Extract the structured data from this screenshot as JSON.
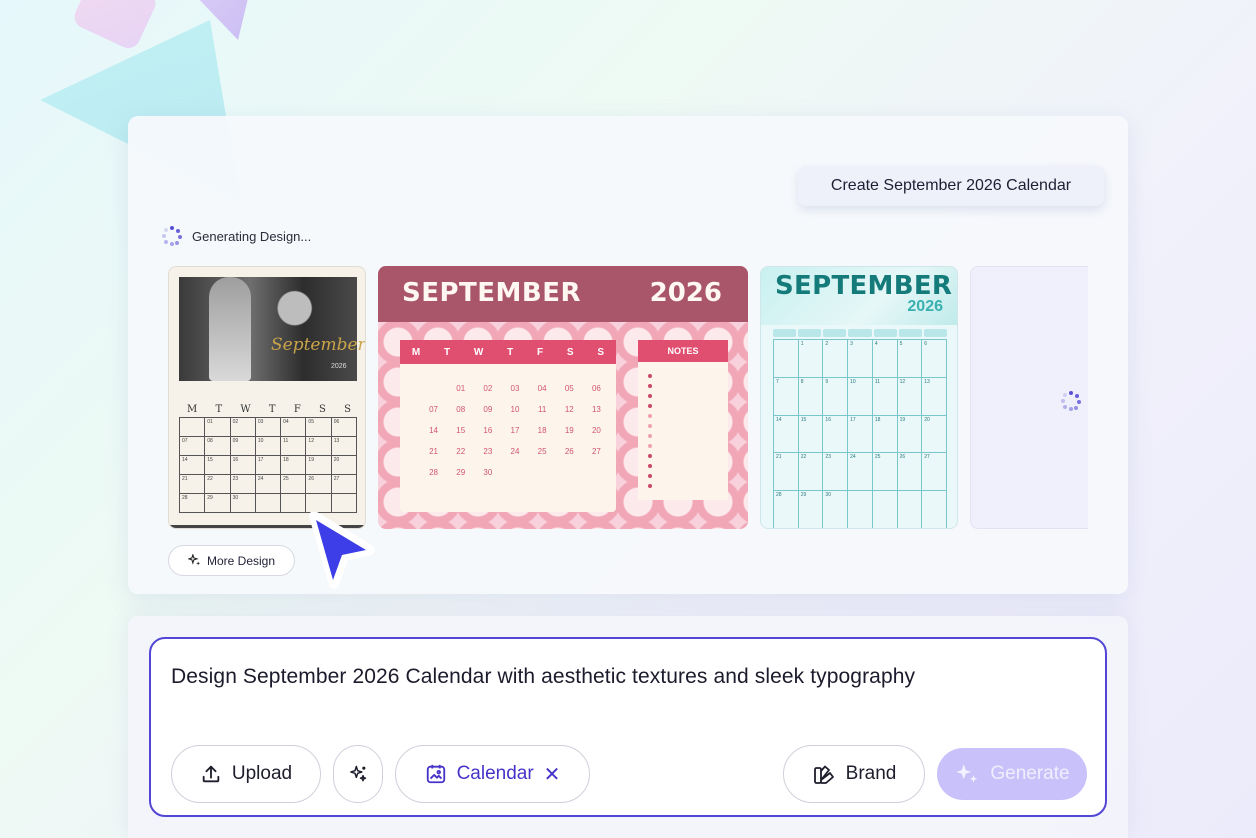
{
  "top_panel": {
    "create_pill": "Create September 2026 Calendar",
    "status": "Generating Design...",
    "more_design": "More Design"
  },
  "card1": {
    "script_title": "September",
    "year": "2026",
    "weekdays": [
      "M",
      "T",
      "W",
      "T",
      "F",
      "S",
      "S"
    ],
    "cells": [
      "",
      "01",
      "02",
      "03",
      "04",
      "05",
      "06",
      "07",
      "08",
      "09",
      "10",
      "11",
      "12",
      "13",
      "14",
      "15",
      "16",
      "17",
      "18",
      "19",
      "20",
      "21",
      "22",
      "23",
      "24",
      "25",
      "26",
      "27",
      "28",
      "29",
      "30",
      "",
      "",
      "",
      ""
    ]
  },
  "card2": {
    "month": "SEPTEMBER",
    "year": "2026",
    "weekdays": [
      "M",
      "T",
      "W",
      "T",
      "F",
      "S",
      "S"
    ],
    "notes_label": "NOTES",
    "days": [
      "",
      "01",
      "02",
      "03",
      "04",
      "05",
      "06",
      "07",
      "08",
      "09",
      "10",
      "11",
      "12",
      "13",
      "14",
      "15",
      "16",
      "17",
      "18",
      "19",
      "20",
      "21",
      "22",
      "23",
      "24",
      "25",
      "26",
      "27",
      "28",
      "29",
      "30",
      "",
      "",
      "",
      ""
    ]
  },
  "card3": {
    "month": "SEPTEMBER",
    "year": "2026",
    "cells": [
      "",
      "1",
      "2",
      "3",
      "4",
      "5",
      "6",
      "7",
      "8",
      "9",
      "10",
      "11",
      "12",
      "13",
      "14",
      "15",
      "16",
      "17",
      "18",
      "19",
      "20",
      "21",
      "22",
      "23",
      "24",
      "25",
      "26",
      "27",
      "28",
      "29",
      "30",
      "",
      "",
      "",
      ""
    ]
  },
  "prompt": {
    "text": "Design September 2026 Calendar with aesthetic textures and sleek typography",
    "upload_label": "Upload",
    "calendar_chip": "Calendar",
    "brand_label": "Brand",
    "generate_label": "Generate"
  },
  "colors": {
    "accent": "#5246d6",
    "card2_header": "#a9566b",
    "card2_accent": "#e04e70",
    "card3_title": "#157a7a",
    "generate_bg": "#c9c2fa"
  },
  "icons": [
    "spinner-icon",
    "sparkle-icon",
    "upload-icon",
    "magic-icon",
    "calendar-image-icon",
    "close-icon",
    "brand-icon",
    "cursor-pointer-icon"
  ]
}
